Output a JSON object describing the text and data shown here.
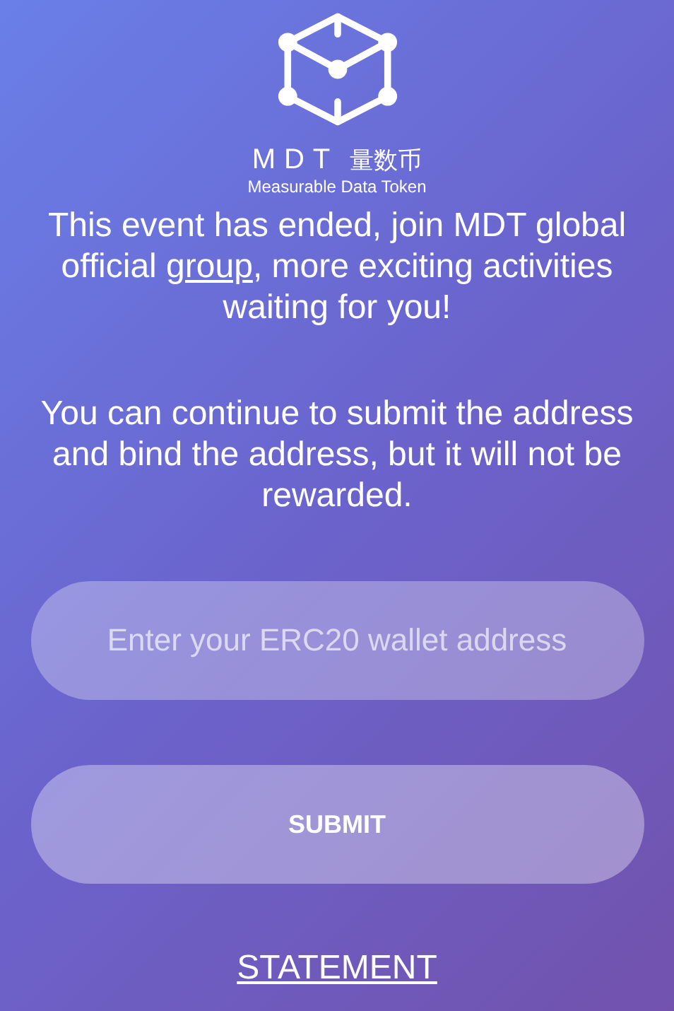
{
  "logo": {
    "brand": "MDT",
    "chinese": "量数币",
    "tagline": "Measurable Data Token"
  },
  "message": {
    "before": "This event has ended, join MDT global official ",
    "link": "group",
    "after": ", more exciting activities waiting for you!"
  },
  "notice": "You can continue to submit the address and bind the address, but it will not be rewarded.",
  "address_field": {
    "placeholder": "Enter your ERC20 wallet address"
  },
  "submit_button": "SUBMIT",
  "statement_link": "STATEMENT"
}
